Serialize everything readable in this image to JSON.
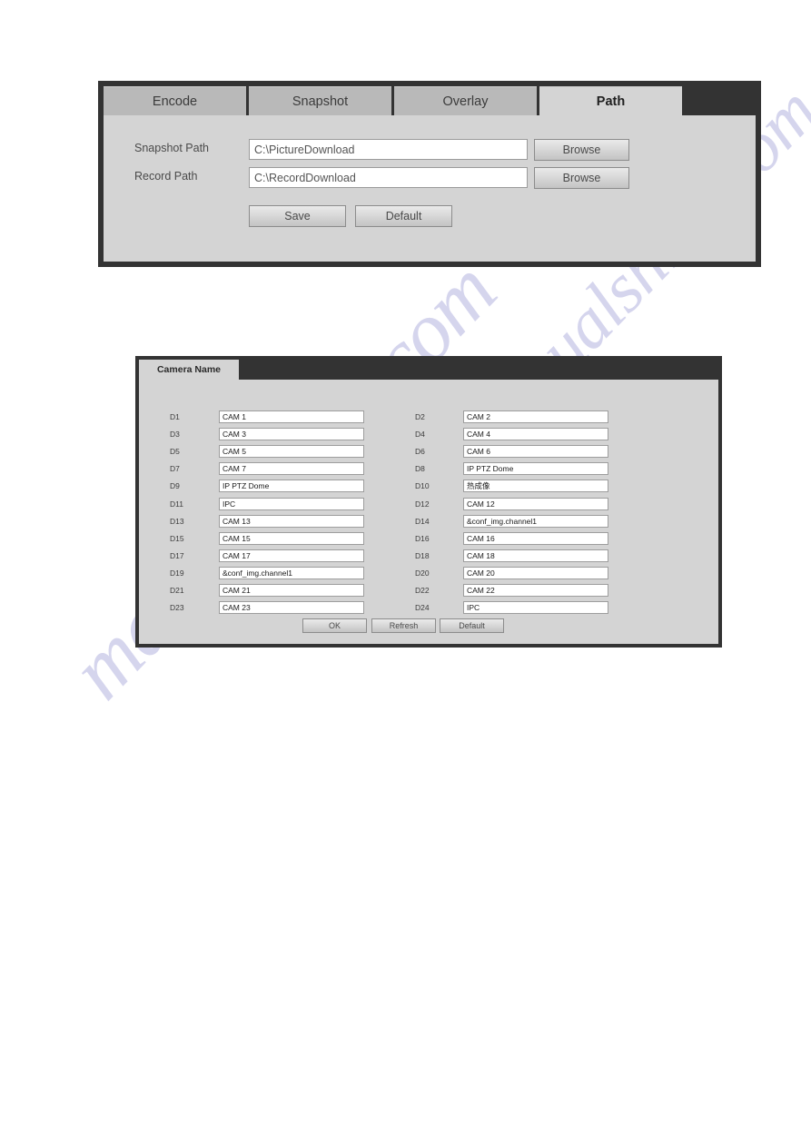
{
  "watermark": {
    "line1": "manualshine.com",
    "line2": "manualshine.com",
    "color": "#b3b3e0"
  },
  "path_panel": {
    "tabs": [
      {
        "label": "Encode",
        "active": false
      },
      {
        "label": "Snapshot",
        "active": false
      },
      {
        "label": "Overlay",
        "active": false
      },
      {
        "label": "Path",
        "active": true
      }
    ],
    "fields": [
      {
        "label": "Snapshot Path",
        "value": "C:\\PictureDownload",
        "browse_label": "Browse"
      },
      {
        "label": "Record Path",
        "value": "C:\\RecordDownload",
        "browse_label": "Browse"
      }
    ],
    "actions": [
      {
        "label": "Save"
      },
      {
        "label": "Default"
      }
    ],
    "colors": {
      "panel_border": "#333333",
      "panel_body": "#d4d4d4",
      "tab_inactive": "#b9b9b9",
      "tab_active": "#d4d4d4"
    }
  },
  "camera_name_panel": {
    "tabs": [
      {
        "label": "Camera Name",
        "active": true
      }
    ],
    "channels": [
      {
        "id": "D1",
        "name": "CAM 1"
      },
      {
        "id": "D2",
        "name": "CAM 2"
      },
      {
        "id": "D3",
        "name": "CAM 3"
      },
      {
        "id": "D4",
        "name": "CAM 4"
      },
      {
        "id": "D5",
        "name": "CAM 5"
      },
      {
        "id": "D6",
        "name": "CAM 6"
      },
      {
        "id": "D7",
        "name": "CAM 7"
      },
      {
        "id": "D8",
        "name": "IP PTZ Dome"
      },
      {
        "id": "D9",
        "name": "IP PTZ Dome"
      },
      {
        "id": "D10",
        "name": "热成像"
      },
      {
        "id": "D11",
        "name": "IPC"
      },
      {
        "id": "D12",
        "name": "CAM 12"
      },
      {
        "id": "D13",
        "name": "CAM 13"
      },
      {
        "id": "D14",
        "name": "&conf_img.channel1"
      },
      {
        "id": "D15",
        "name": "CAM 15"
      },
      {
        "id": "D16",
        "name": "CAM 16"
      },
      {
        "id": "D17",
        "name": "CAM 17"
      },
      {
        "id": "D18",
        "name": "CAM 18"
      },
      {
        "id": "D19",
        "name": "&conf_img.channel1"
      },
      {
        "id": "D20",
        "name": "CAM 20"
      },
      {
        "id": "D21",
        "name": "CAM 21"
      },
      {
        "id": "D22",
        "name": "CAM 22"
      },
      {
        "id": "D23",
        "name": "CAM 23"
      },
      {
        "id": "D24",
        "name": "IPC"
      }
    ],
    "actions": [
      {
        "label": "OK"
      },
      {
        "label": "Refresh"
      },
      {
        "label": "Default"
      }
    ]
  }
}
